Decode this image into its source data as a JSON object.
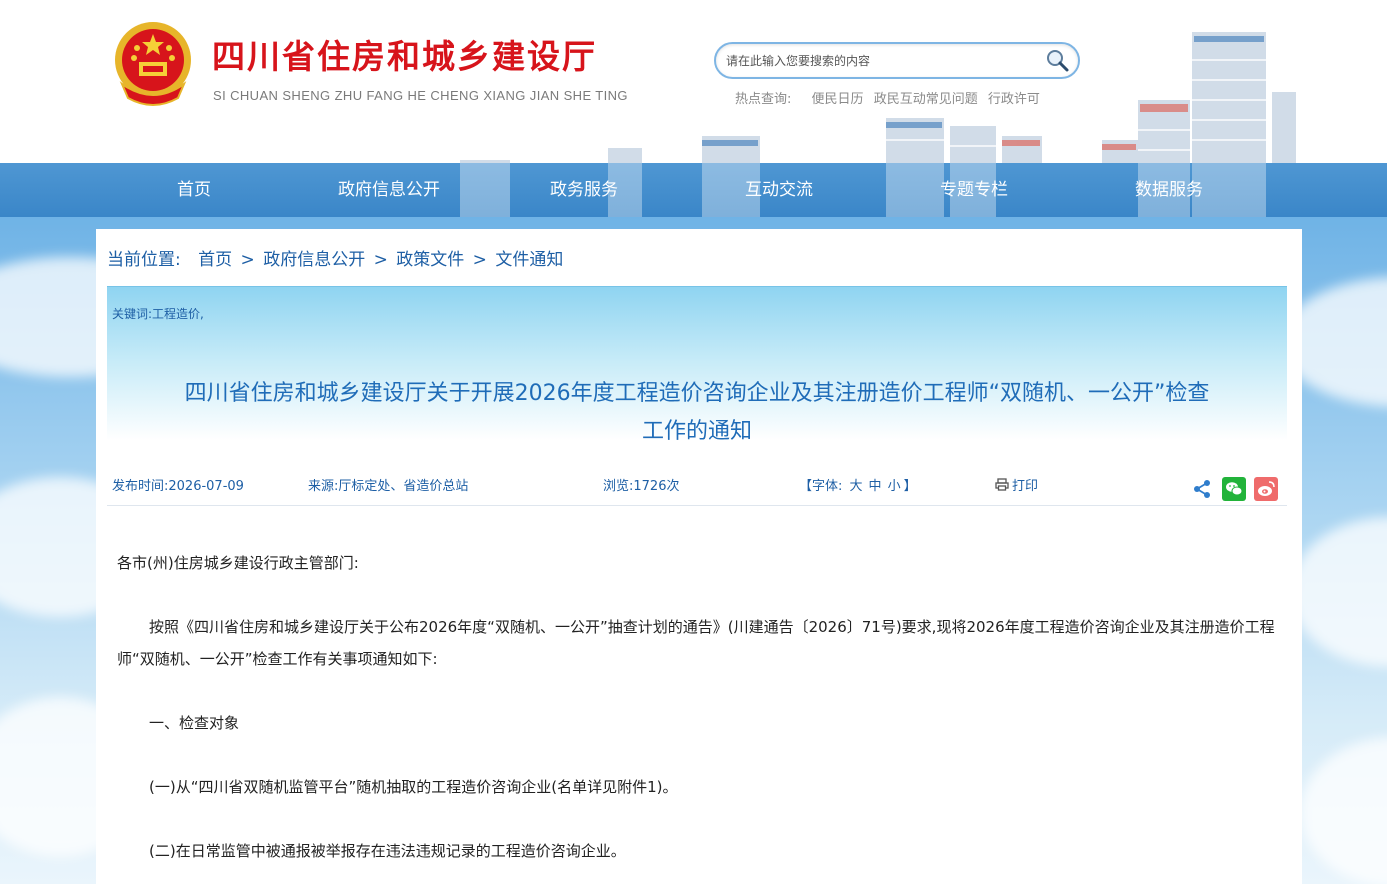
{
  "header": {
    "site_title": "四川省住房和城乡建设厅",
    "site_pinyin": "SI CHUAN SHENG ZHU FANG HE CHENG XIANG JIAN SHE TING",
    "search": {
      "placeholder": "请在此输入您要搜索的内容"
    },
    "hot": {
      "label": "热点查询:",
      "links": [
        "便民日历",
        "政民互动常见问题",
        "行政许可"
      ]
    },
    "brand_color": "#d7141b"
  },
  "nav": {
    "items": [
      "首页",
      "政府信息公开",
      "政务服务",
      "互动交流",
      "专题专栏",
      "数据服务"
    ],
    "color": "#3a86c8"
  },
  "breadcrumb": {
    "label": "当前位置:",
    "items": [
      "首页",
      "政府信息公开",
      "政策文件",
      "文件通知"
    ],
    "sep": ">"
  },
  "article": {
    "keywords": "关键词:工程造价,",
    "title_line1": "四川省住房和城乡建设厅关于开展2026年度工程造价咨询企业及其注册造价工程师“双随机、一公开”检查",
    "title_line2": "工作的通知",
    "meta": {
      "publish_label": "发布时间:",
      "publish_date": "2026-07-09",
      "source_label": "来源:",
      "source": "厅标定处、省造价总站",
      "views_label": "浏览:",
      "views": "1726次",
      "font_label": "【字体:",
      "font_large": "大",
      "font_medium": "中",
      "font_small": "小",
      "font_close": "】",
      "print": "打印"
    },
    "paragraphs": [
      "各市(州)住房城乡建设行政主管部门:",
      "按照《四川省住房和城乡建设厅关于公布2026年度“双随机、一公开”抽查计划的通告》(川建通告〔2026〕71号)要求,现将2026年度工程造价咨询企业及其注册造价工程师“双随机、一公开”检查工作有关事项通知如下:",
      "一、检查对象",
      "(一)从“四川省双随机监管平台”随机抽取的工程造价咨询企业(名单详见附件1)。",
      "(二)在日常监管中被通报被举报存在违法违规记录的工程造价咨询企业。"
    ]
  }
}
